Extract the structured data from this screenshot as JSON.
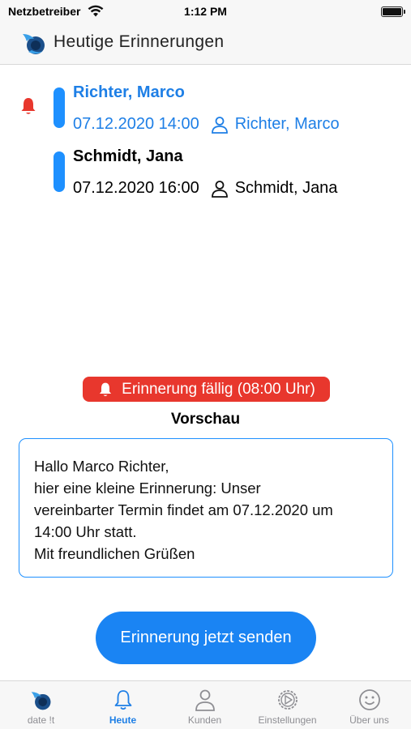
{
  "status_bar": {
    "carrier": "Netzbetreiber",
    "time": "1:12 PM"
  },
  "header": {
    "title": "Heutige Erinnerungen"
  },
  "appointments": [
    {
      "name": "Richter, Marco",
      "datetime": "07.12.2020 14:00",
      "customer": "Richter, Marco",
      "selected": true
    },
    {
      "name": "Schmidt, Jana",
      "datetime": "07.12.2020 16:00",
      "customer": "Schmidt, Jana",
      "selected": false
    }
  ],
  "reminder": {
    "badge": "Erinnerung fällig (08:00 Uhr)",
    "preview_heading": "Vorschau",
    "preview_lines": [
      "Hallo Marco Richter,",
      "hier eine kleine Erinnerung: Unser",
      "vereinbarter Termin findet am 07.12.2020 um",
      "14:00 Uhr statt.",
      "Mit freundlichen Grüßen"
    ],
    "send_button": "Erinnerung jetzt senden"
  },
  "tabs": [
    {
      "label": "date !t",
      "icon": "app-logo-icon"
    },
    {
      "label": "Heute",
      "icon": "bell-icon",
      "active": true
    },
    {
      "label": "Kunden",
      "icon": "person-icon"
    },
    {
      "label": "Einstellungen",
      "icon": "gear-icon"
    },
    {
      "label": "Über uns",
      "icon": "smiley-icon"
    }
  ],
  "colors": {
    "accent": "#1e7fe6",
    "alert": "#e8372d"
  }
}
